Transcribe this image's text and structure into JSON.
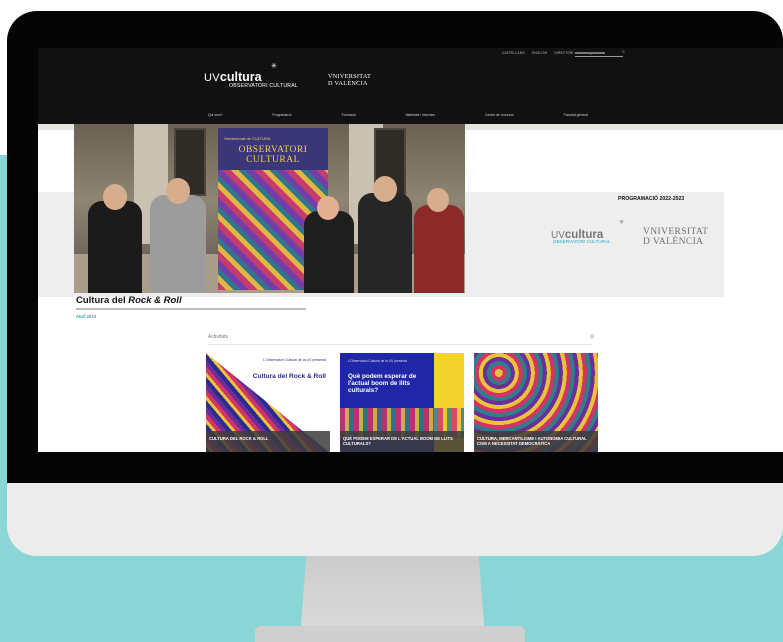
{
  "site": {
    "utility_links": [
      "CASTELLANO",
      "ENGLISH",
      "DIRECTORI"
    ],
    "utility_icons": [
      "user-icon",
      "grid-icon"
    ],
    "search": {
      "placeholder": ""
    },
    "logo": {
      "uv": "UV",
      "cultura": "cultura",
      "subtitle": "OBSERVATORI CULTURAL",
      "university_line1": "VNIVERSITAT",
      "university_line2": "D VALÈNCIA"
    },
    "nav": [
      "Qui som?",
      "Programació",
      "Formació",
      "Materials i informes",
      "Centre de recursos",
      "Facultat general"
    ]
  },
  "hero": {
    "title_plain": "Cultura del ",
    "title_italic": "Rock & Roll",
    "date": "Abril 2023",
    "banner_small": "Vicerectorat de CULTURA",
    "banner_line1": "OBSERVATORI",
    "banner_line2": "CULTURAL"
  },
  "promo": {
    "title": "PROGRAMACIÓ 2022-2023",
    "uv": "UV",
    "cultura": "cultura",
    "subtitle": "OBSERVATORI CULTURAL",
    "university_line1": "VNIVERSITAT",
    "university_line2": "D VALÈNCIA"
  },
  "activitats": {
    "heading": "Activitats",
    "close_symbol": "⊠",
    "cards": [
      {
        "small": "L'Observatori Cultural de la UV presenta",
        "big": "Cultura del Rock & Roll",
        "caption": "CULTURA DEL ROCK & ROLL"
      },
      {
        "small": "L'Observatori Cultural de la UV presenta",
        "big": "Què podem esperar de l'actual boom de llits culturals?",
        "caption": "QUÈ PODEM ESPERAR DE L'ACTUAL BOOM DE LLITS CULTURALS?"
      },
      {
        "small": "",
        "big": "",
        "caption": "CULTURA, MERCANTILISME I AUTONOMIA CULTURAL COM A NECESSITAT DEMOCRÀTICA"
      }
    ]
  }
}
